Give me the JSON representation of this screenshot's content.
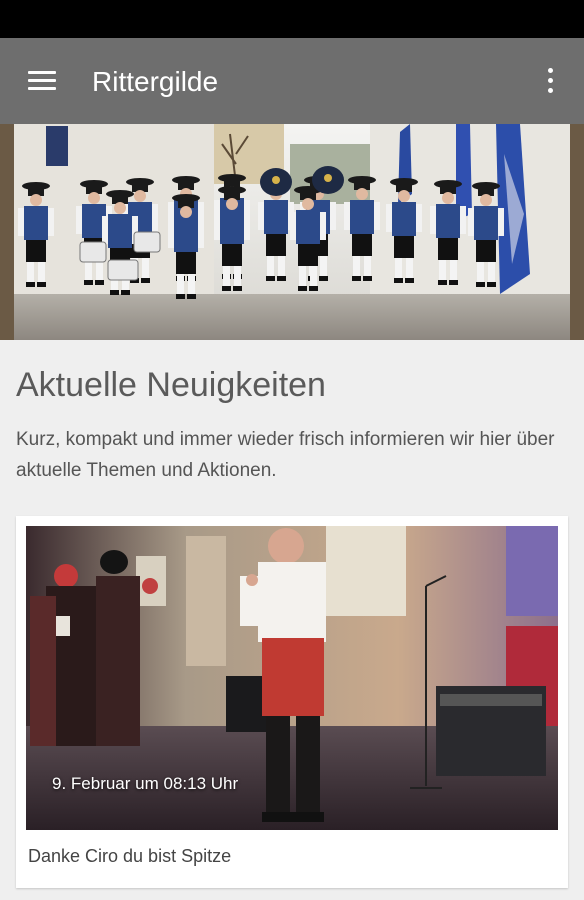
{
  "appbar": {
    "title": "Rittergilde",
    "menu_icon": "hamburger-menu-icon",
    "overflow_icon": "more-vertical-icon"
  },
  "colors": {
    "appbar": "#6e6e6e",
    "statusbar": "#000000",
    "background": "#efefef",
    "card": "#ffffff"
  },
  "news_section": {
    "title": "Aktuelle Neuigkeiten",
    "description": "Kurz, kompakt und immer wieder frisch informieren wir hier über aktuelle Themen und Aktionen."
  },
  "news_items": [
    {
      "date": "9. Februar um 08:13 Uhr",
      "caption": "Danke Ciro du bist Spitze"
    }
  ]
}
